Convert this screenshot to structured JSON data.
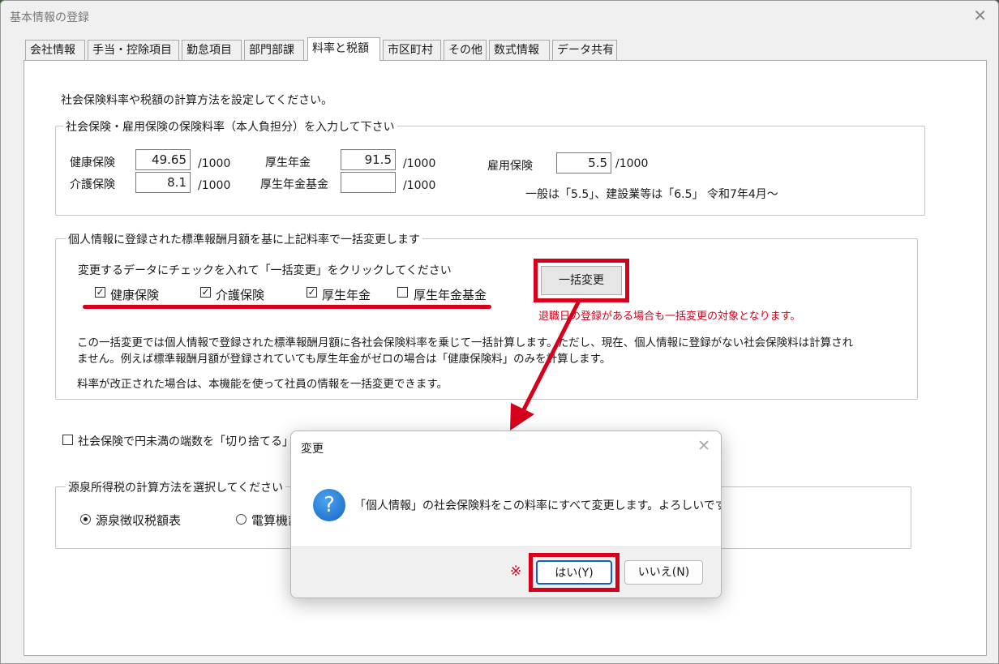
{
  "window": {
    "title": "基本情報の登録",
    "close": "✕"
  },
  "tabs": [
    "会社情報",
    "手当・控除項目",
    "勤怠項目",
    "部門部課",
    "料率と税額",
    "市区町村",
    "その他",
    "数式情報",
    "データ共有"
  ],
  "active_tab": "料率と税額",
  "intro_text": "社会保険料率や税額の計算方法を設定してください。",
  "rates_group": {
    "legend": "社会保険・雇用保険の保険料率（本人負担分）を入力して下さい",
    "health_label": "健康保険",
    "health_value": "49.65",
    "care_label": "介護保険",
    "care_value": "8.1",
    "pension_label": "厚生年金",
    "pension_value": "91.5",
    "pension_fund_label": "厚生年金基金",
    "pension_fund_value": "",
    "employment_label": "雇用保険",
    "employment_value": "5.5",
    "unit": "/1000",
    "employment_note": "一般は「5.5」、建設業等は「6.5」 令和7年4月～"
  },
  "bulk_group": {
    "legend": "個人情報に登録された標準報酬月額を基に上記料率で一括変更します",
    "instruction": "変更するデータにチェックを入れて「一括変更」をクリックしてください",
    "checkboxes": [
      {
        "label": "健康保険",
        "checked": true
      },
      {
        "label": "介護保険",
        "checked": true
      },
      {
        "label": "厚生年金",
        "checked": true
      },
      {
        "label": "厚生年金基金",
        "checked": false
      }
    ],
    "check_mark": "✓",
    "button_label": "一括変更",
    "red_note": "退職日の登録がある場合も一括変更の対象となります。",
    "description_line1": "この一括変更では個人情報で登録された標準報酬月額に各社会保険料率を乗じて一括計算します。ただし、現在、個人情報に登録がない社会保険料は計算され",
    "description_line2": "ません。例えば標準報酬月額が登録されていても厚生年金がゼロの場合は「健康保険料」のみを計算します。",
    "description_line3": "料率が改正された場合は、本機能を使って社員の情報を一括変更できます。"
  },
  "rounding": {
    "label": "社会保険で円未満の端数を「切り捨てる」（",
    "checked": false
  },
  "tax_group": {
    "legend": "源泉所得税の計算方法を選択してください",
    "options": [
      {
        "label": "源泉徴収税額表",
        "selected": true
      },
      {
        "label": "電算機計",
        "selected": false
      }
    ]
  },
  "dialog": {
    "title": "変更",
    "close": "✕",
    "icon": "?",
    "message": "「個人情報」の社会保険料をこの料率にすべて変更します。よろしいですか？",
    "marker": "※",
    "yes_label": "はい(Y)",
    "no_label": "いいえ(N)"
  },
  "colors": {
    "accent_red": "#d6001c",
    "dialog_primary_border": "#0f5fcc"
  }
}
